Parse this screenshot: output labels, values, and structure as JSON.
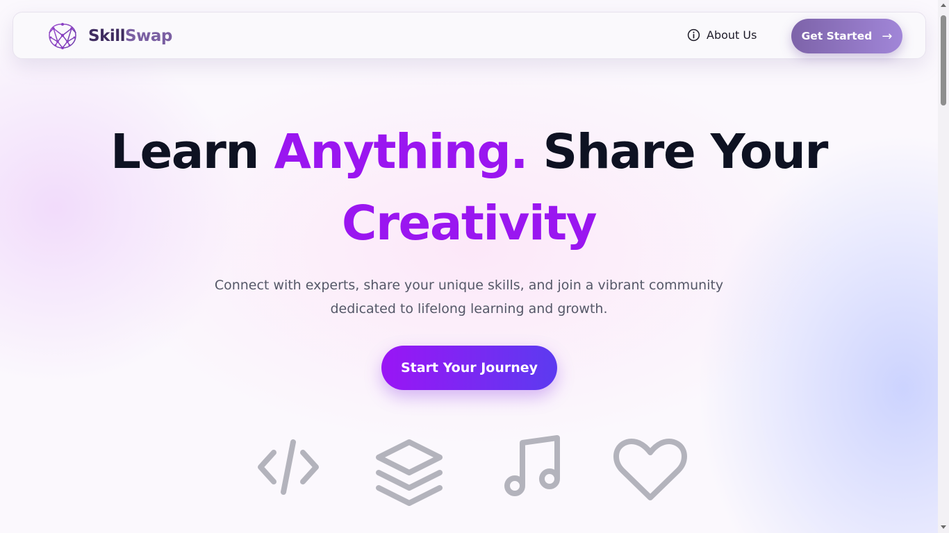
{
  "navbar": {
    "brand_part1": "Skill",
    "brand_part2": "Swap",
    "logo_icon": "brain-network-icon",
    "about_label": "About Us",
    "about_icon": "info-icon",
    "get_started_label": "Get Started",
    "get_started_arrow": "→"
  },
  "hero": {
    "title_part1": "Learn ",
    "title_accent1": "Anything.",
    "title_part2": " Share Your",
    "title_accent2": "Creativity",
    "subtitle_line1": "Connect with experts, share your unique skills, and join a vibrant community",
    "subtitle_line2": "dedicated to lifelong learning and growth.",
    "cta_label": "Start Your Journey"
  },
  "skill_icons": [
    "code-icon",
    "layers-icon",
    "music-icon",
    "heart-icon"
  ],
  "colors": {
    "accent_purple": "#9a16f0",
    "cta_gradient_start": "#9a15f5",
    "cta_gradient_end": "#5c3bf0",
    "nav_button_start": "#7d63a9",
    "nav_button_end": "#a186d8",
    "heading_dark": "#0e1222",
    "icon_gray": "#b3b3bc"
  }
}
